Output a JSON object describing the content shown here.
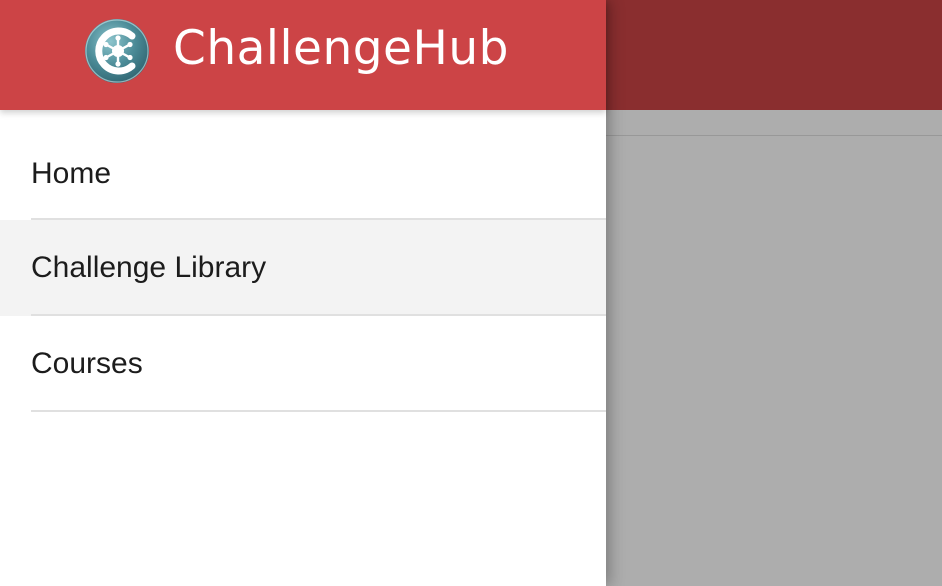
{
  "app": {
    "brand_name": "ChallengeHub",
    "header_color": "#cc4446",
    "logo_colors": {
      "outer": "#3e7a88",
      "inner": "#5fa0ac",
      "mark": "#ffffff"
    }
  },
  "nav": {
    "items": [
      {
        "label": "Home",
        "active": false
      },
      {
        "label": "Challenge Library",
        "active": true
      },
      {
        "label": "Courses",
        "active": false
      }
    ]
  },
  "colors": {
    "drawer_bg": "#ffffff",
    "active_item_bg": "#f3f3f3",
    "divider": "#e0e0e0",
    "text": "#1c1c1c"
  }
}
